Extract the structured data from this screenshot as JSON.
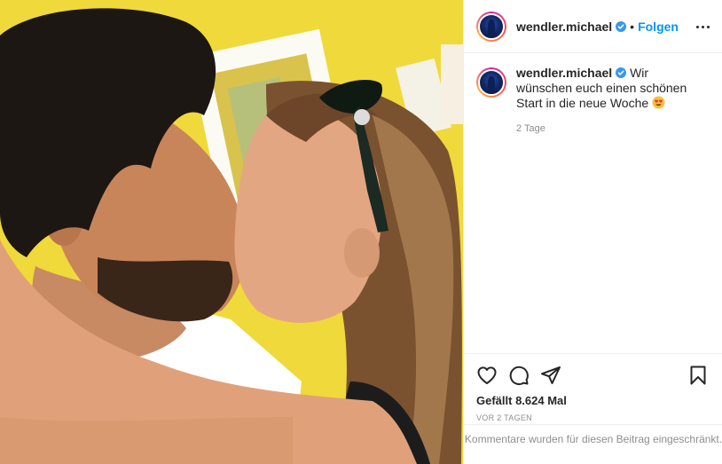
{
  "post": {
    "username": "wendler.michael",
    "follow_label": "Folgen",
    "separator": "•",
    "caption_text": "Wir wünschen euch einen schönen Start in die neue Woche",
    "caption_emoji": "heart-eyes-emoji",
    "caption_time": "2 Tage",
    "likes": "Gefällt 8.624 Mal",
    "time_ago": "VOR 2 TAGEN",
    "comments_restricted": "Kommentare wurden für diesen Beitrag eingeschränkt."
  },
  "colors": {
    "accent": "#0095f6",
    "text": "#262626",
    "muted": "#8e8e8e",
    "wall": "#f2dc3a"
  },
  "icons": [
    "verified-badge-icon",
    "more-options-icon",
    "like-heart-icon",
    "comment-icon",
    "share-icon",
    "bookmark-icon"
  ]
}
